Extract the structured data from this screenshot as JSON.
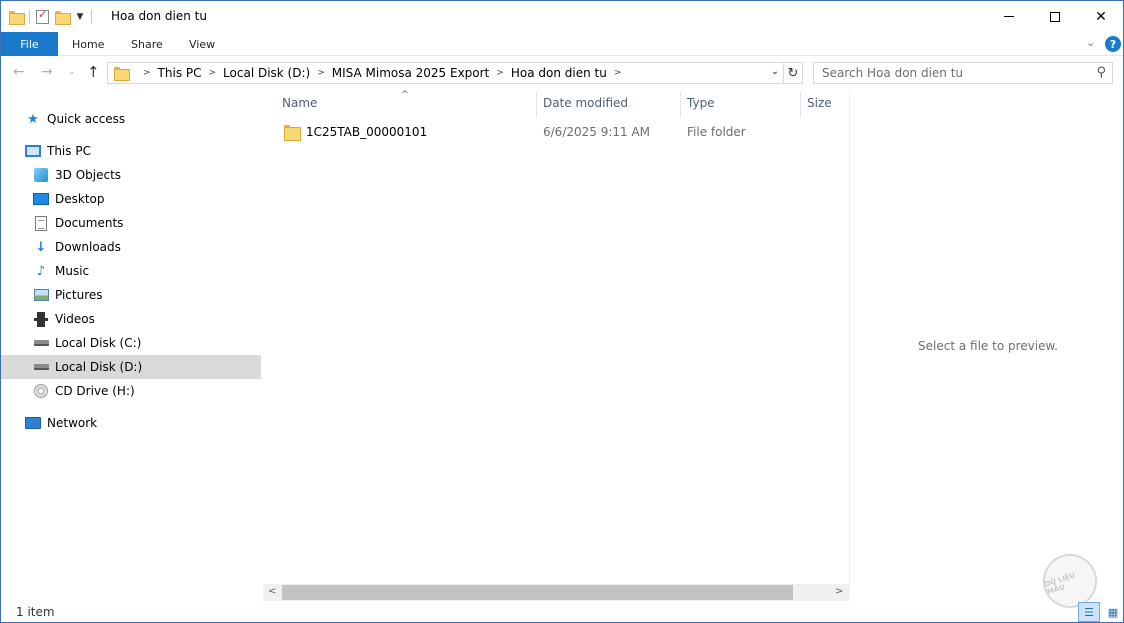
{
  "window": {
    "title": "Hoa don dien tu",
    "min_glyph": "",
    "close_glyph": "✕"
  },
  "ribbon": {
    "file": "File",
    "home": "Home",
    "share": "Share",
    "view": "View",
    "help_glyph": "?"
  },
  "address": {
    "crumbs": [
      "This PC",
      "Local Disk (D:)",
      "MISA Mimosa 2025 Export",
      "Hoa don dien tu"
    ],
    "search_placeholder": "Search Hoa don dien tu"
  },
  "nav": {
    "quick_access": "Quick access",
    "this_pc": "This PC",
    "items": [
      "3D Objects",
      "Desktop",
      "Documents",
      "Downloads",
      "Music",
      "Pictures",
      "Videos",
      "Local Disk (C:)",
      "Local Disk (D:)",
      "CD Drive (H:)"
    ],
    "network": "Network",
    "selected": "Local Disk (D:)"
  },
  "columns": {
    "name": "Name",
    "date": "Date modified",
    "type": "Type",
    "size": "Size"
  },
  "files": [
    {
      "name": "1C25TAB_00000101",
      "date": "6/6/2025 9:11 AM",
      "type": "File folder"
    }
  ],
  "preview": {
    "text": "Select a file to preview."
  },
  "status": {
    "count": "1 item"
  },
  "watermark": "DỮ LIỆU MẪU",
  "accent_color": "#1979ca"
}
